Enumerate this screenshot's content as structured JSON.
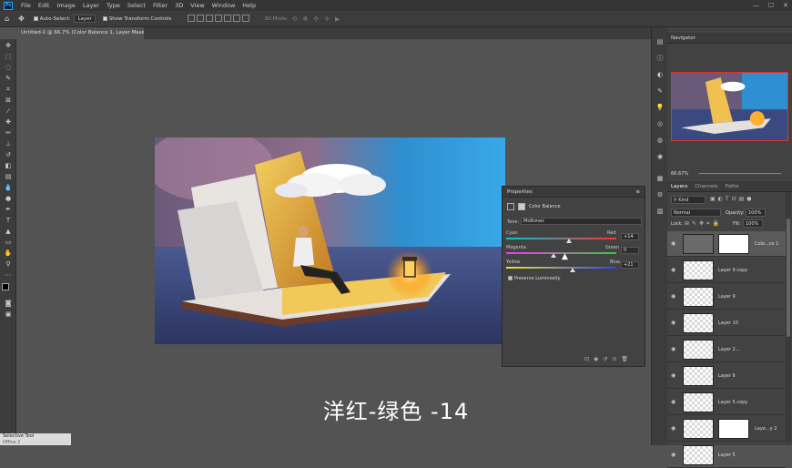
{
  "menubar": {
    "logo": "Ps",
    "items": [
      "File",
      "Edit",
      "Image",
      "Layer",
      "Type",
      "Select",
      "Filter",
      "3D",
      "View",
      "Window",
      "Help"
    ],
    "window_controls": [
      "—",
      "☐",
      "✕"
    ]
  },
  "options_bar": {
    "auto_select_label": "Auto-Select:",
    "auto_select_target": "Layer",
    "show_transform_label": "Show Transform Controls",
    "mode_label": "3D Mode:"
  },
  "document_tab": {
    "title": "Untitled-1 @ 66.7% (Color Balance 1, Layer Mask/8) *"
  },
  "subtitle": "洋红-绿色 -14",
  "properties": {
    "panel_title": "Properties",
    "adjustment_name": "Color Balance",
    "tone_label": "Tone:",
    "tone_value": "Midtones",
    "sliders": [
      {
        "left": "Cyan",
        "right": "Red",
        "value": "+14",
        "level": 14,
        "gradient": [
          "#00c8d8",
          "#ff3030"
        ]
      },
      {
        "left": "Magenta",
        "right": "Green",
        "value": "0",
        "level": -14,
        "gradient": [
          "#ff30ff",
          "#30d030"
        ]
      },
      {
        "left": "Yellow",
        "right": "Blue",
        "value": "+21",
        "level": 21,
        "gradient": [
          "#e8e830",
          "#3040ff"
        ]
      }
    ],
    "preserve_label": "Preserve Luminosity"
  },
  "navigator": {
    "title": "Navigator",
    "zoom": "66.67%"
  },
  "layers_panel": {
    "tabs": [
      "Layers",
      "Channels",
      "Paths"
    ],
    "kind_label": "Kind",
    "blend_mode": "Normal",
    "opacity_label": "Opacity:",
    "opacity_value": "100%",
    "lock_label": "Lock:",
    "fill_label": "Fill:",
    "fill_value": "100%",
    "layers": [
      {
        "name": "Colo...ce 1",
        "selected": true
      },
      {
        "name": "Layer 9 copy"
      },
      {
        "name": "Layer 9"
      },
      {
        "name": "Layer 10"
      },
      {
        "name": "Layer 2..."
      },
      {
        "name": "Layer 6"
      },
      {
        "name": "Layer 5 copy"
      },
      {
        "name": "Laye...y 2"
      },
      {
        "name": "Layer 5"
      }
    ]
  },
  "selective_tool": {
    "title": "Selective Tool",
    "subtitle": "Office 2"
  }
}
